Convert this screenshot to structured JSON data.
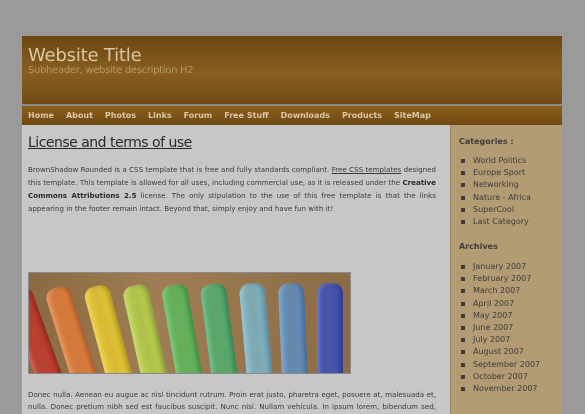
{
  "header": {
    "title": "Website Title",
    "subtitle": "Subheader, website description H2"
  },
  "nav": [
    "Home",
    "About",
    "Photos",
    "Links",
    "Forum",
    "Free Stuff",
    "Downloads",
    "Products",
    "SiteMap"
  ],
  "content": {
    "heading": "License and terms of use",
    "intro_1": "BrownShadow Rounded is a CSS template that is free and fully standards compliant. ",
    "intro_link": "Free CSS templates",
    "intro_2": " designed this template. This template is allowed for all uses, including commercial use, as it is released under the ",
    "intro_bold": "Creative Commons Attributions 2.5",
    "intro_3": " license. The only stipulation to the use of this free template is that the links appearing in the footer remain intact. Beyond that, simply enjoy and have fun with it!",
    "paragraph_2": "Donec nulla. Aenean eu augue ac nisl tincidunt rutrum. Proin erat justo, pharetra eget, posuere at, malesuada et, nulla. Donec pretium nibh sed est faucibus suscipit. Nunc nisi. Nullam vehicula. In ipsum lorem, bibendum sed, consectetuer et, gravida id, erat. Ut imperdiet, leo vel condimentum faucibus, risus"
  },
  "sidebar": {
    "categories_heading": "Categories :",
    "categories": [
      "World Politics",
      "Europe Sport",
      "Networking",
      "Nature - Africa",
      "SuperCool",
      "Last Category"
    ],
    "archives_heading": "Archives",
    "archives": [
      "January 2007",
      "February 2007",
      "March 2007",
      "April 2007",
      "May 2007",
      "June 2007",
      "July 2007",
      "August 2007",
      "September 2007",
      "October 2007",
      "November 2007"
    ]
  },
  "photo": {
    "marker_colors": [
      "#c0392b",
      "#e07b39",
      "#e8c930",
      "#b6d14a",
      "#5bb85b",
      "#4fae6e",
      "#7ab4c8",
      "#5d8fc0",
      "#3b4fb8"
    ]
  }
}
